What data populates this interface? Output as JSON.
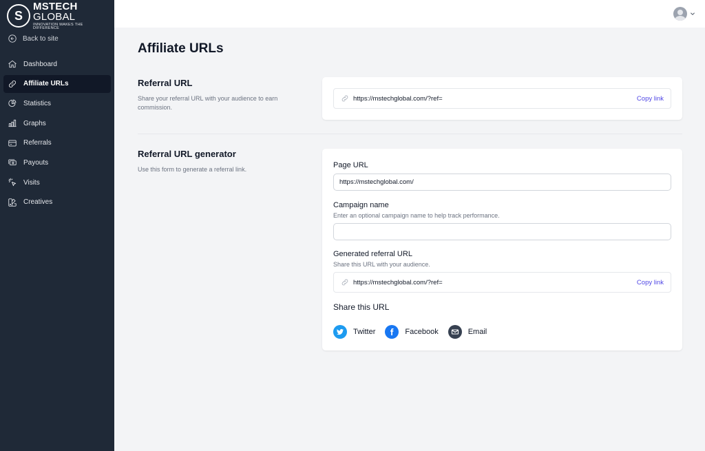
{
  "brand": {
    "name_bold": "MSTECH",
    "name_light": " GLOBAL",
    "tagline": "INNOVATION MAKES THE DIFFERENCE"
  },
  "sidebar": {
    "back_label": "Back to site",
    "items": [
      {
        "label": "Dashboard",
        "icon": "home-icon"
      },
      {
        "label": "Affiliate URLs",
        "icon": "link-icon",
        "active": true
      },
      {
        "label": "Statistics",
        "icon": "pie-chart-icon"
      },
      {
        "label": "Graphs",
        "icon": "bar-chart-icon"
      },
      {
        "label": "Referrals",
        "icon": "credit-card-icon"
      },
      {
        "label": "Payouts",
        "icon": "cash-icon"
      },
      {
        "label": "Visits",
        "icon": "cursor-click-icon"
      },
      {
        "label": "Creatives",
        "icon": "color-swatch-icon"
      }
    ]
  },
  "page": {
    "title": "Affiliate URLs"
  },
  "referral": {
    "title": "Referral URL",
    "description": "Share your referral URL with your audience to earn commission.",
    "url": "https://mstechglobal.com/?ref=",
    "copy_label": "Copy link"
  },
  "generator": {
    "title": "Referral URL generator",
    "description": "Use this form to generate a referral link.",
    "page_url_label": "Page URL",
    "page_url_value": "https://mstechglobal.com/",
    "campaign_label": "Campaign name",
    "campaign_help": "Enter an optional campaign name to help track performance.",
    "campaign_value": "",
    "generated_label": "Generated referral URL",
    "generated_help": "Share this URL with your audience.",
    "generated_url": "https://mstechglobal.com/?ref=",
    "copy_label": "Copy link",
    "share_title": "Share this URL",
    "share": {
      "twitter": "Twitter",
      "facebook": "Facebook",
      "email": "Email"
    }
  },
  "colors": {
    "sidebar_bg": "#1f2937",
    "accent": "#4f46e5",
    "twitter": "#1d9bf0",
    "facebook": "#1877f2",
    "email": "#374151"
  }
}
